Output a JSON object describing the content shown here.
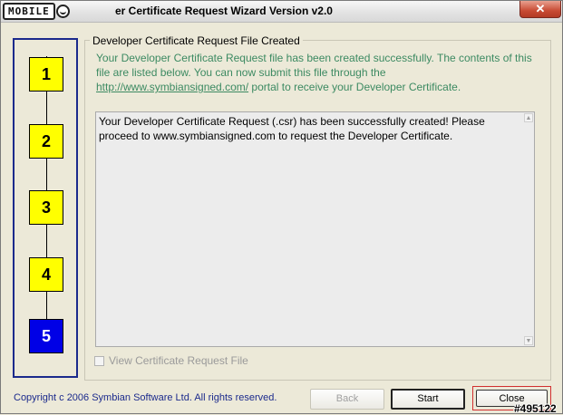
{
  "window": {
    "title": "er Certificate Request Wizard Version v2.0",
    "logo_text": "MOBILE",
    "close_glyph": "✕"
  },
  "steps": [
    "1",
    "2",
    "3",
    "4",
    "5"
  ],
  "active_step": "5",
  "group": {
    "legend": "Developer Certificate Request File Created",
    "intro_text": "Your Developer Certificate Request file has been created successfully. The contents of this file are listed below. You can now submit this file through the",
    "link_text": "http://www.symbiansigned.com/",
    "intro_suffix": "portal to receive your Developer Certificate."
  },
  "csr_content": "Your Developer Certificate Request (.csr) has been successfully created! Please proceed to www.symbiansigned.com to request the Developer Certificate.",
  "checkbox": {
    "label": "View Certificate Request File",
    "checked": false,
    "enabled": false
  },
  "footer": {
    "copyright": "Copyright c 2006 Symbian Software Ltd. All rights reserved.",
    "back_label": "Back",
    "start_label": "Start",
    "close_label": "Close",
    "watermark": "#495122"
  },
  "colors": {
    "step_yellow": "#ffff00",
    "step_active": "#0000e6",
    "intro_green": "#3c8a62",
    "panel_border": "#1b2a8c"
  },
  "icons": {
    "close": "close-icon",
    "scroll_up": "scroll-up-icon",
    "scroll_down": "scroll-down-icon"
  }
}
